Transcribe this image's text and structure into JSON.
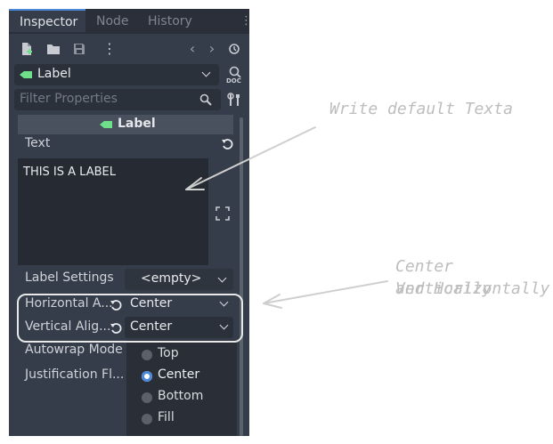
{
  "tabs": [
    "Inspector",
    "Node",
    "History"
  ],
  "node_selector": {
    "label": "Label"
  },
  "filter": {
    "placeholder": "Filter Properties"
  },
  "section": {
    "title": "Label"
  },
  "text_property": {
    "label": "Text",
    "value": "THIS IS A LABEL"
  },
  "label_settings": {
    "label": "Label Settings",
    "value": "<empty>"
  },
  "horizontal_alignment": {
    "label": "Horizontal A...",
    "value": "Center"
  },
  "vertical_alignment": {
    "label": "Vertical Alig...",
    "value": "Center"
  },
  "autowrap": {
    "label": "Autowrap Mode"
  },
  "justification": {
    "label": "Justification Fl..."
  },
  "dropdown_options": [
    {
      "label": "Top",
      "selected": false
    },
    {
      "label": "Center",
      "selected": true
    },
    {
      "label": "Bottom",
      "selected": false
    },
    {
      "label": "Fill",
      "selected": false
    }
  ],
  "annotations": {
    "text_note": "Write default Texta",
    "align_note_line1": "Center Vertically",
    "align_note_line2": "and Horizontally"
  },
  "icons": [
    "new-script-icon",
    "open-folder-icon",
    "save-icon",
    "more-vertical-icon",
    "back-icon",
    "forward-icon",
    "history-icon",
    "docs-icon",
    "search-icon",
    "tools-icon",
    "revert-icon",
    "expand-icon"
  ],
  "colors": {
    "panel_bg": "#363d4a",
    "accent": "#4c88d9",
    "node_tag": "#6fe08a",
    "annotation": "#bdbdbd"
  }
}
